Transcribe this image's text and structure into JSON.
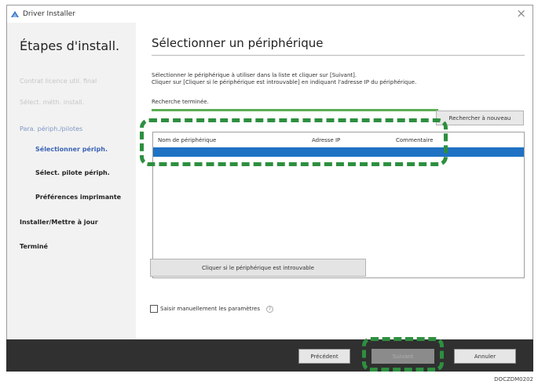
{
  "window": {
    "title": "Driver Installer",
    "close_glyph": "×"
  },
  "sidebar": {
    "title": "Étapes d'install.",
    "steps": [
      {
        "label": "Contrat licence util. final",
        "state": "done"
      },
      {
        "label": "Sélect. méth. install.",
        "state": "done"
      },
      {
        "label": "Para. périph./pilotes",
        "state": "current-parent"
      },
      {
        "label": "Sélectionner périph.",
        "state": "active"
      },
      {
        "label": "Sélect. pilote périph.",
        "state": "pending"
      },
      {
        "label": "Préférences imprimante",
        "state": "pending"
      },
      {
        "label": "Installer/Mettre à jour",
        "state": "pending"
      },
      {
        "label": "Terminé",
        "state": "pending"
      }
    ]
  },
  "main": {
    "title": "Sélectionner un périphérique",
    "instruction_line1": "Sélectionner le périphérique à utiliser dans la liste et cliquer sur [Suivant].",
    "instruction_line2": "Cliquer sur [Cliquer si le périphérique est introuvable] en indiquant l'adresse IP du périphérique.",
    "status": "Recherche terminée.",
    "search_again_label": "Rechercher à nouveau",
    "table": {
      "columns": [
        "Nom de périphérique",
        "Adresse IP",
        "Commentaire"
      ],
      "rows": [
        {
          "name": "",
          "ip": "",
          "comment": ""
        }
      ]
    },
    "not_found_label": "Cliquer si le périphérique est introuvable",
    "manual_label": "Saisir manuellement les paramètres",
    "manual_checked": false,
    "help_glyph": "?"
  },
  "footer": {
    "prev_label": "Précédent",
    "next_label": "Suivant",
    "cancel_label": "Annuler"
  },
  "figure_code": "DOCZDM0202",
  "colors": {
    "highlight": "#2d8f3f",
    "selection": "#1f72c4",
    "footer": "#303030",
    "active_step": "#3b63b6"
  }
}
